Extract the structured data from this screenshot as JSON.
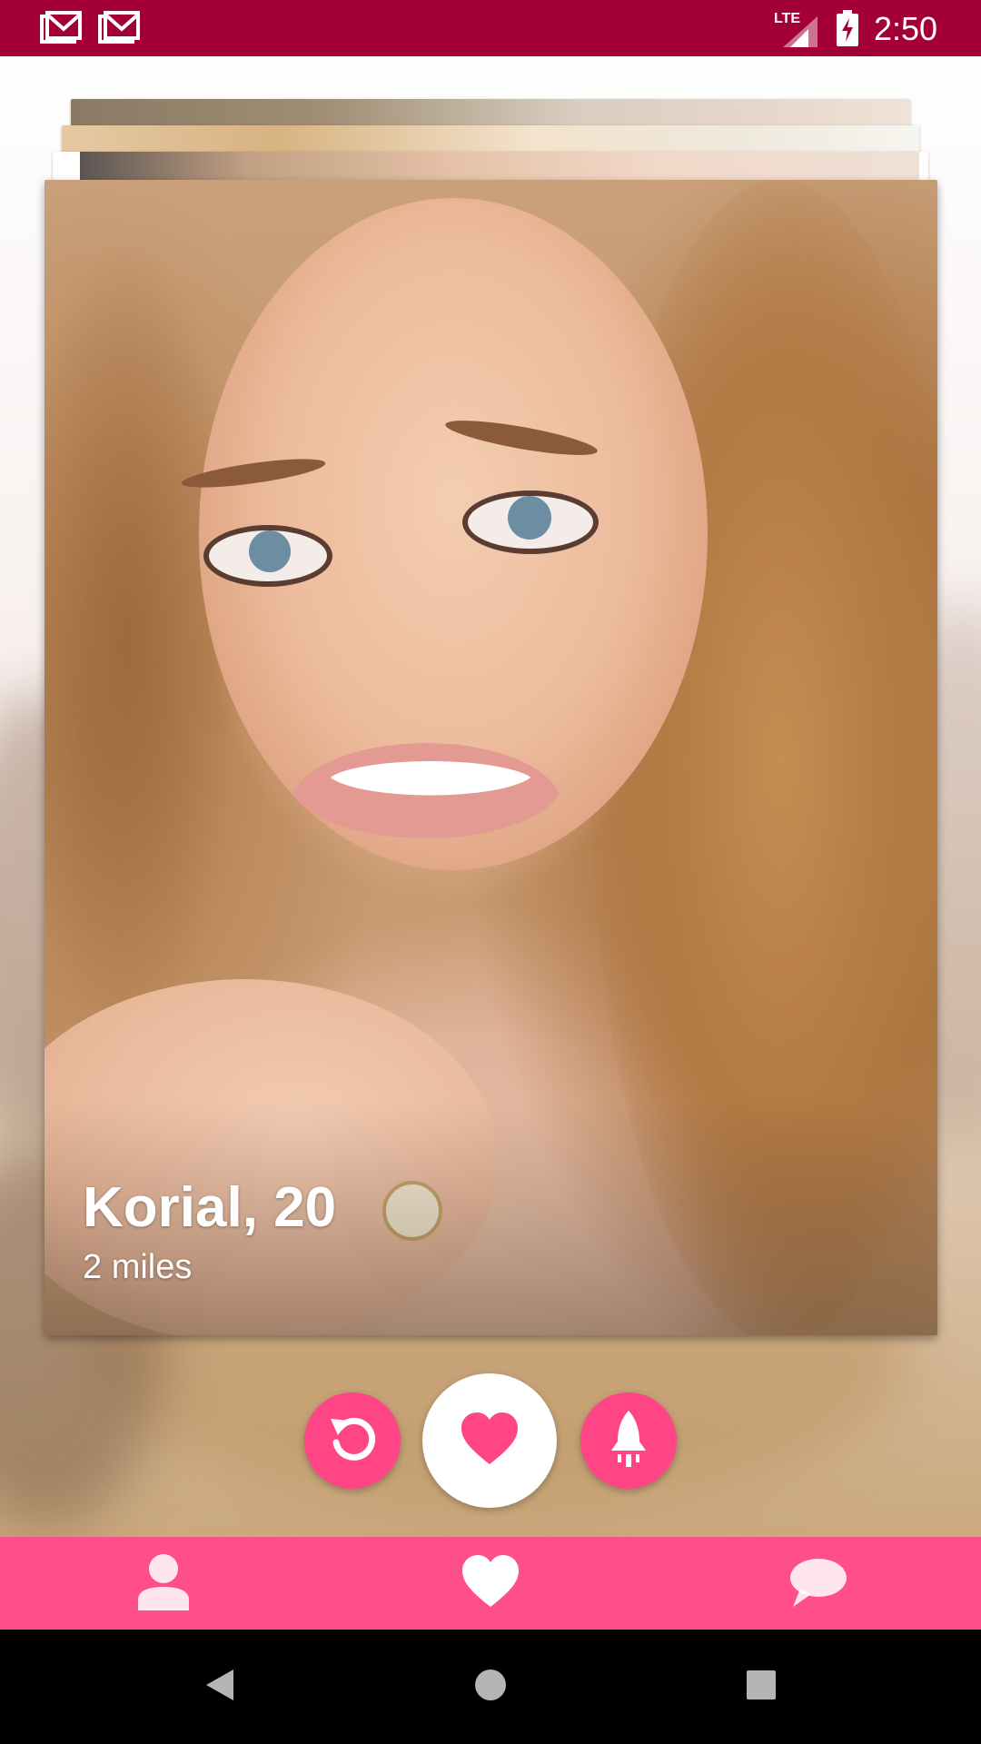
{
  "status_bar": {
    "time": "2:50",
    "network": "LTE",
    "notification_icons": [
      "gmail-icon",
      "gmail-icon"
    ]
  },
  "profile": {
    "name_age": "Korial, 20",
    "distance": "2 miles"
  },
  "actions": {
    "undo_icon": "undo-icon",
    "like_icon": "heart-icon",
    "boost_icon": "rocket-icon"
  },
  "bottom_nav": {
    "items": [
      {
        "icon": "profile-icon"
      },
      {
        "icon": "heart-icon",
        "active": true
      },
      {
        "icon": "chat-icon"
      }
    ]
  },
  "colors": {
    "status_bar": "#a3003a",
    "accent": "#ff4585",
    "nav_bar": "#ff4f8b"
  }
}
